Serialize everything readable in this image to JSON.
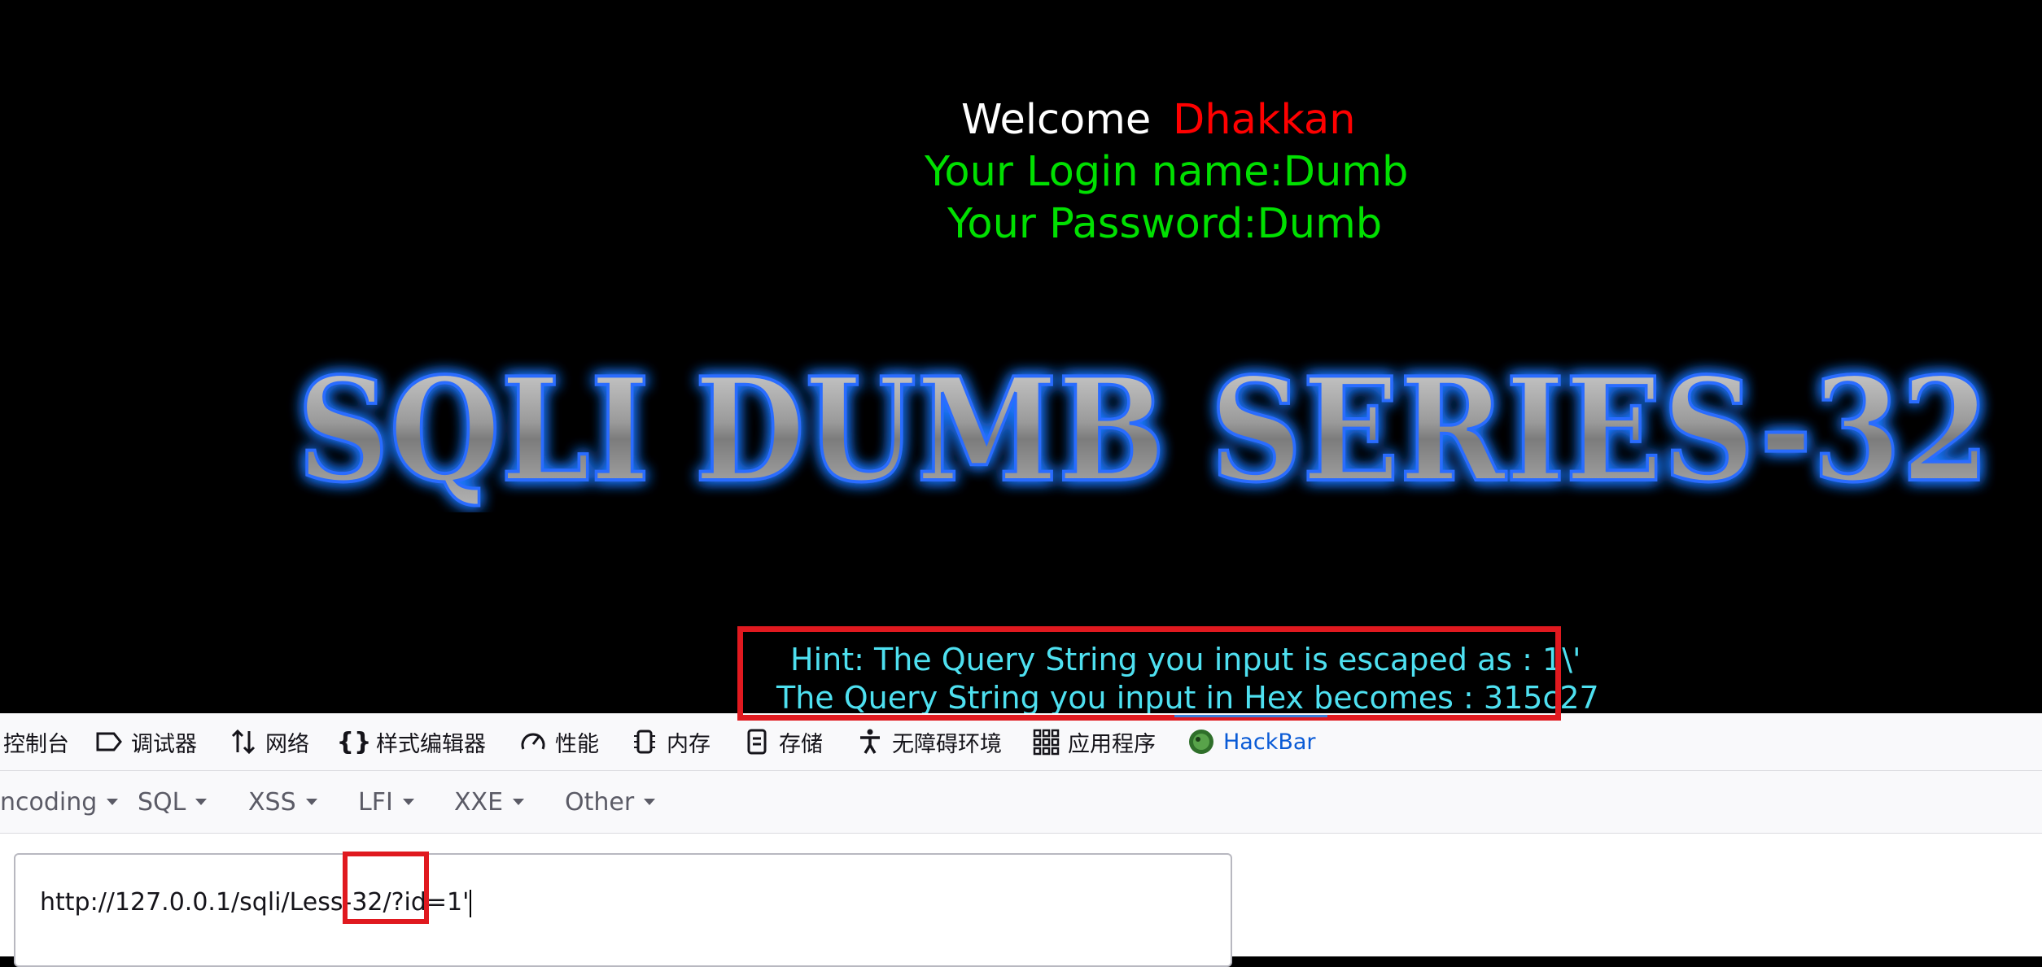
{
  "welcome": {
    "greeting": "Welcome",
    "name": "Dhakkan",
    "login_line": "Your Login name:Dumb",
    "password_line": "Your Password:Dumb"
  },
  "banner": {
    "title": "SQLI DUMB SERIES-32"
  },
  "hint": {
    "line1": "Hint: The Query String you input is escaped as : 1\\'",
    "line2": "The Query String you input in Hex becomes : 315c27"
  },
  "devtools": {
    "tabs": [
      {
        "label": "控制台",
        "icon": "console-icon"
      },
      {
        "label": "调试器",
        "icon": "debugger-icon"
      },
      {
        "label": "网络",
        "icon": "network-icon"
      },
      {
        "label": "样式编辑器",
        "icon": "style-editor-icon"
      },
      {
        "label": "性能",
        "icon": "performance-icon"
      },
      {
        "label": "内存",
        "icon": "memory-icon"
      },
      {
        "label": "存储",
        "icon": "storage-icon"
      },
      {
        "label": "无障碍环境",
        "icon": "accessibility-icon"
      },
      {
        "label": "应用程序",
        "icon": "application-icon"
      },
      {
        "label": "HackBar",
        "icon": "hackbar-icon"
      }
    ]
  },
  "hackbar": {
    "menu": [
      "ncoding",
      "SQL",
      "XSS",
      "LFI",
      "XXE",
      "Other"
    ],
    "url_value": "http://127.0.0.1/sqli/Less-32/?id=1'"
  },
  "colors": {
    "accent_red": "#e0191f",
    "hint_cyan": "#4ee0f0",
    "text_green": "#00e000",
    "name_red": "#ff0000",
    "hackbar_blue": "#0a5bd6"
  }
}
